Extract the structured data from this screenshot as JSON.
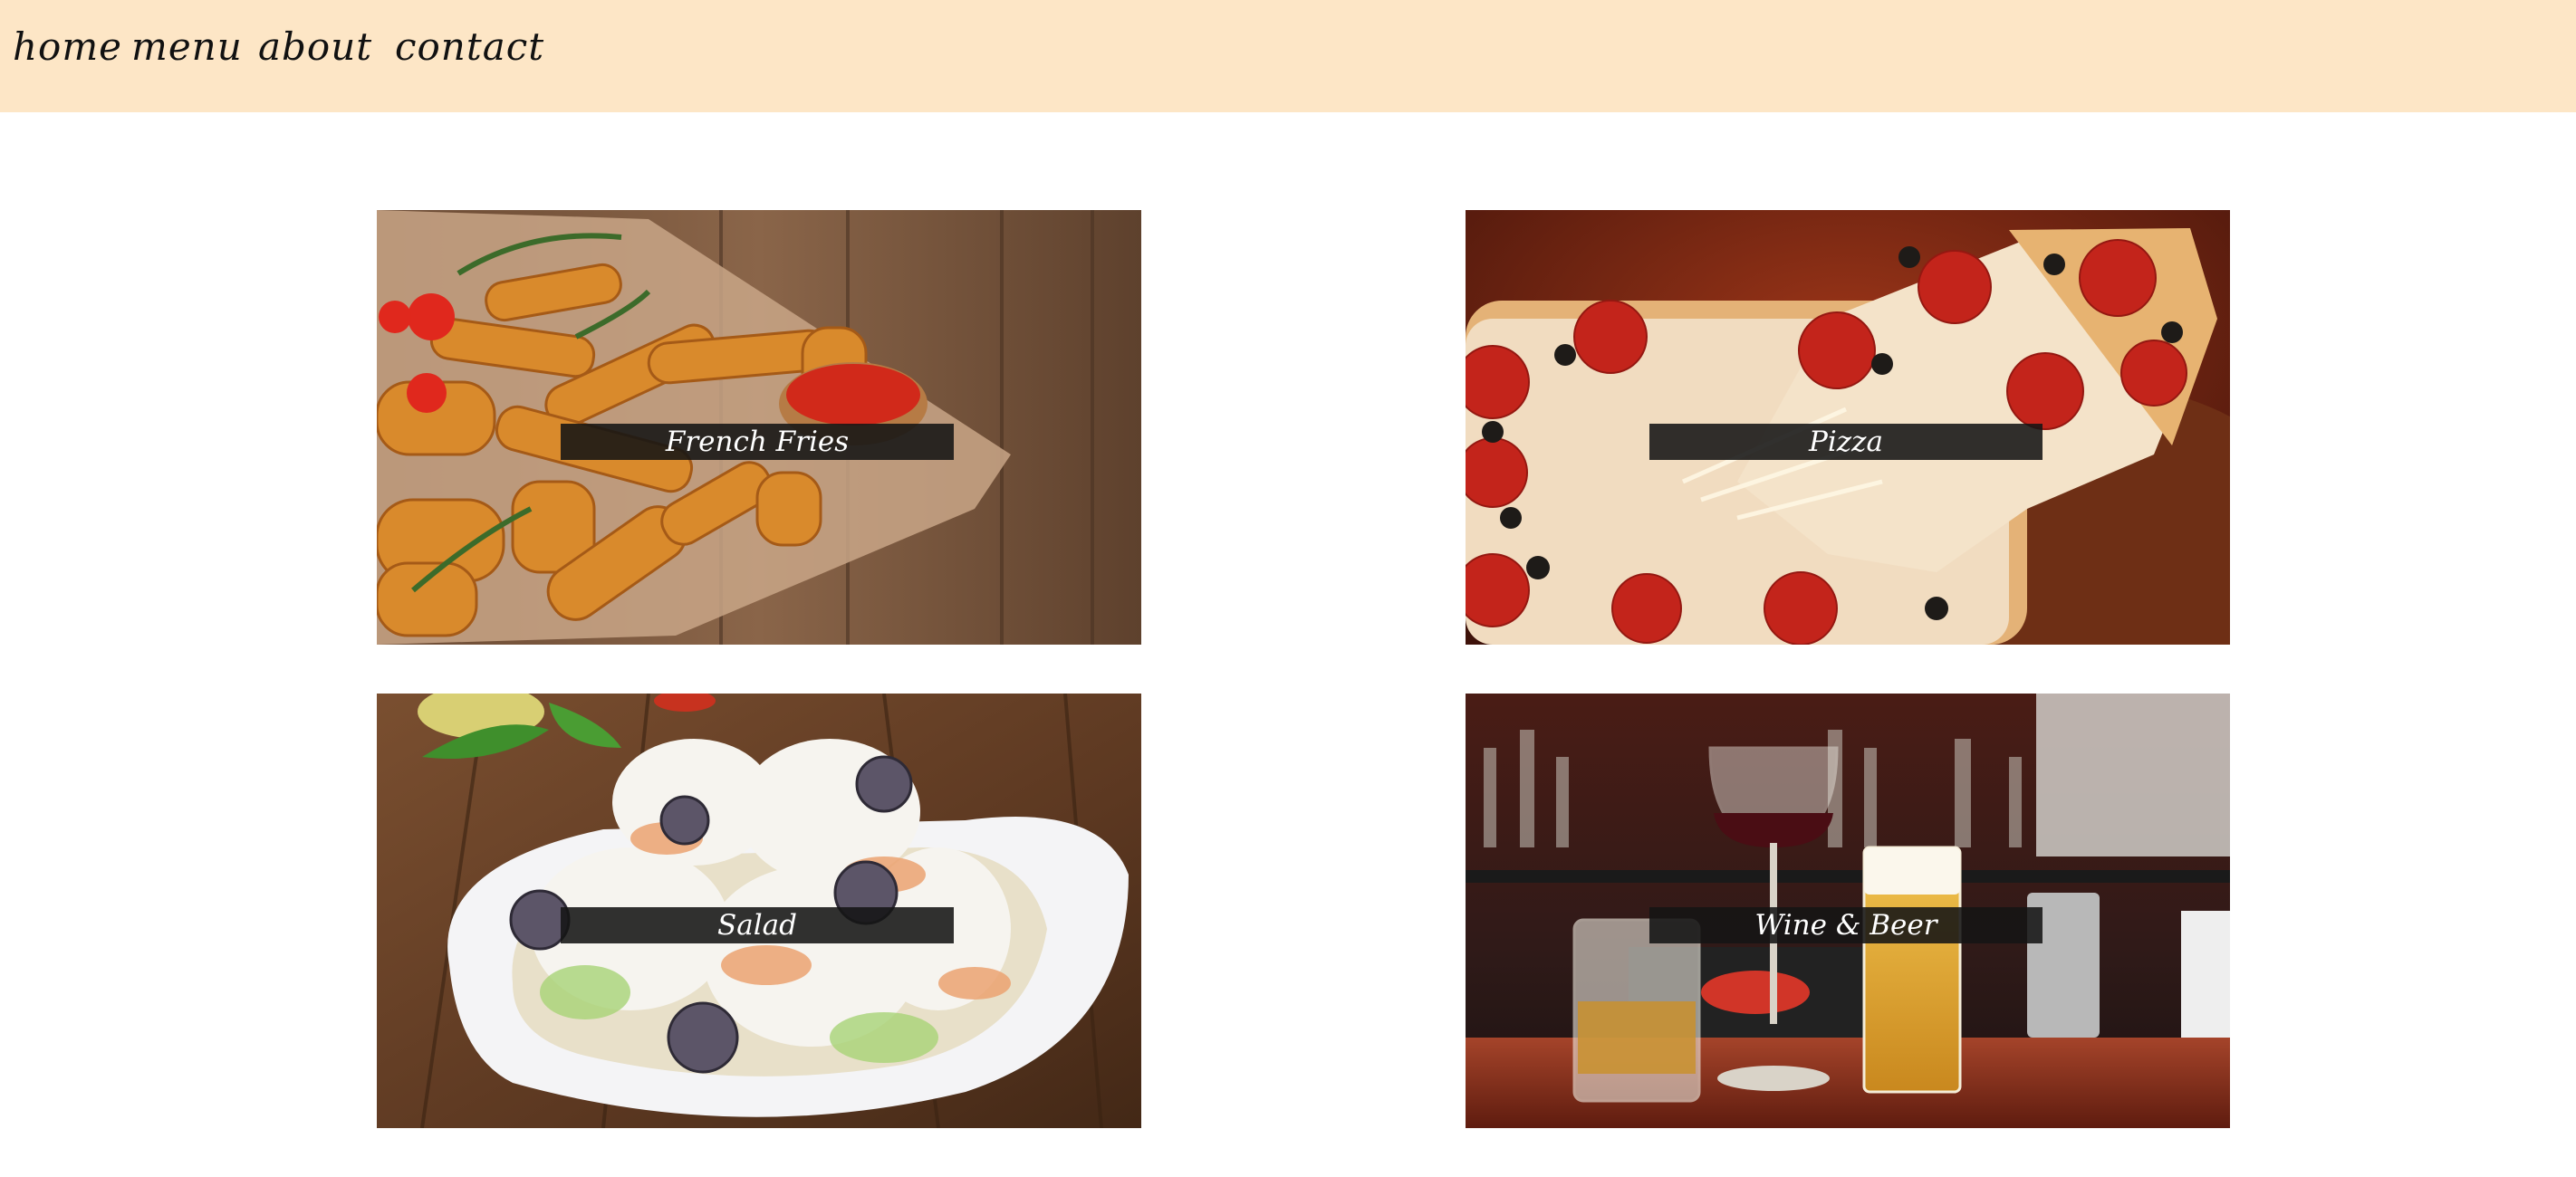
{
  "nav": {
    "items": [
      {
        "label": "home"
      },
      {
        "label": "menu"
      },
      {
        "label": "about"
      },
      {
        "label": "contact"
      }
    ]
  },
  "menu_cards": [
    {
      "label": "French Fries"
    },
    {
      "label": "Pizza"
    },
    {
      "label": "Salad"
    },
    {
      "label": "Wine & Beer"
    }
  ],
  "colors": {
    "nav_background": "#fde6c6",
    "page_background": "#ffffff",
    "label_background": "#141414",
    "label_text": "#ffffff"
  }
}
